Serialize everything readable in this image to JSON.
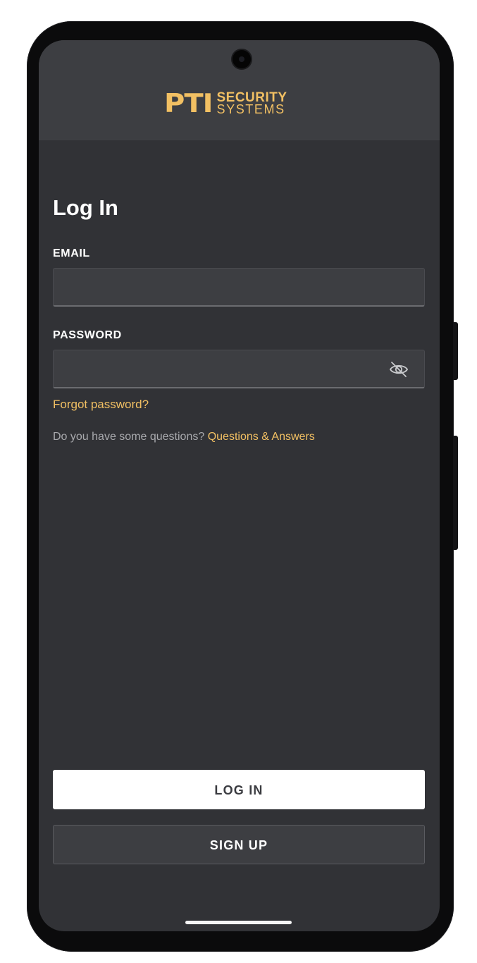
{
  "header": {
    "logo_mark": "PTI",
    "logo_line1": "SECURITY",
    "logo_line2": "SYSTEMS"
  },
  "login": {
    "title": "Log In",
    "email_label": "EMAIL",
    "email_value": "",
    "password_label": "PASSWORD",
    "password_value": "",
    "forgot_password": "Forgot password?",
    "questions_prompt": "Do you have some questions?",
    "questions_link": "Questions & Answers"
  },
  "actions": {
    "login_label": "LOG IN",
    "signup_label": "SIGN UP"
  },
  "icons": {
    "camera": "camera-icon",
    "password_toggle": "eye-off-icon"
  },
  "colors": {
    "accent": "#f2c063",
    "background": "#313236",
    "header": "#3d3e42",
    "input": "#3d3e42",
    "text": "#ffffff",
    "muted_text": "#a9aaae"
  }
}
